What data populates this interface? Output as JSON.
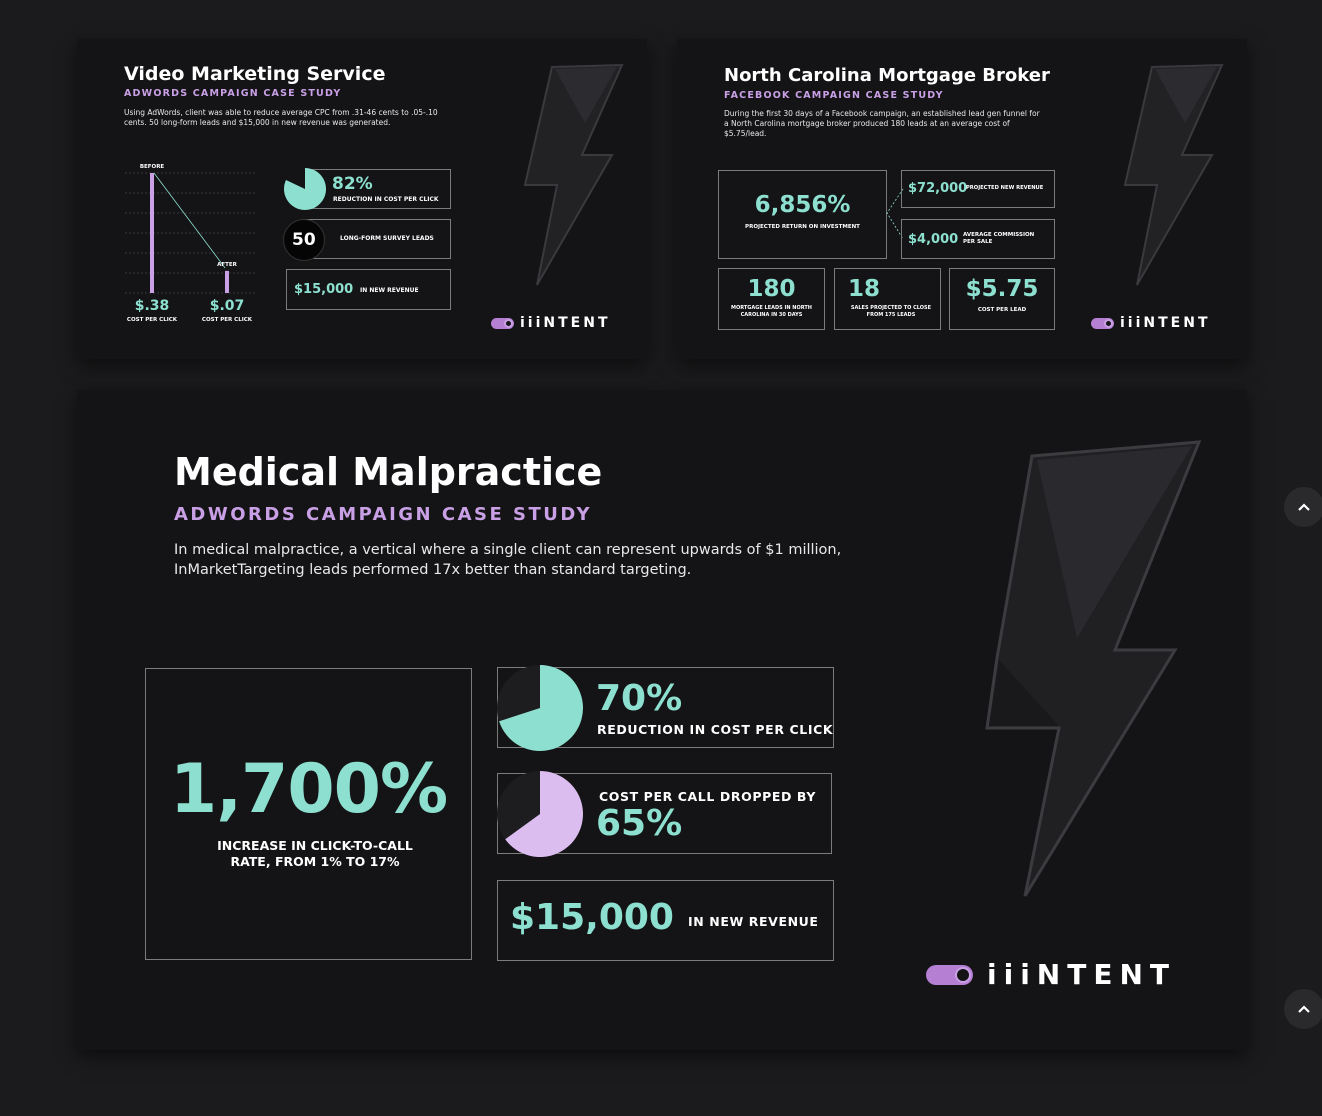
{
  "card1": {
    "title": "Video Marketing Service",
    "subtitle": "ADWORDS CAMPAIGN CASE STUDY",
    "description": "Using AdWords, client was able to reduce average CPC from .31-46 cents to .05-.10 cents. 50 long-form leads and $15,000 in new revenue was generated.",
    "chart_data": {
      "type": "bar",
      "categories": [
        "BEFORE",
        "AFTER"
      ],
      "values": [
        0.38,
        0.07
      ],
      "value_labels": [
        "$.38",
        "$.07"
      ],
      "xlabel": "COST PER CLICK",
      "grid": true
    },
    "stat1": {
      "value": "82%",
      "label": "REDUCTION IN COST PER CLICK",
      "fraction": 0.82
    },
    "stat2": {
      "value": "50",
      "label": "LONG-FORM SURVEY LEADS"
    },
    "stat3": {
      "value": "$15,000",
      "label": "IN NEW REVENUE"
    },
    "logo": "iiiNTENT"
  },
  "card2": {
    "title": "North Carolina Mortgage Broker",
    "subtitle": "FACEBOOK CAMPAIGN CASE STUDY",
    "description": "During the first 30 days of a Facebook campaign, an established lead gen funnel for a North Carolina mortgage broker produced 180 leads at an average cost of $5.75/lead.",
    "roi": {
      "value": "6,856%",
      "label": "PROJECTED RETURN ON INVESTMENT"
    },
    "revenue": {
      "value": "$72,000",
      "label": "PROJECTED NEW REVENUE"
    },
    "commission": {
      "value": "$4,000",
      "label": "AVERAGE COMMISSION PER SALE"
    },
    "leads": {
      "value": "180",
      "label": "MORTGAGE LEADS IN NORTH CAROLINA IN 30 DAYS"
    },
    "sales": {
      "value": "18",
      "label": "SALES PROJECTED TO CLOSE FROM 175 LEADS"
    },
    "cpl": {
      "value": "$5.75",
      "label": "COST PER LEAD"
    },
    "logo": "iiiNTENT"
  },
  "card3": {
    "title": "Medical Malpractice",
    "subtitle": "ADWORDS CAMPAIGN CASE STUDY",
    "description": "In medical malpractice, a vertical where a single client can represent upwards of $1 million, InMarketTargeting leads performed 17x better than standard targeting.",
    "big": {
      "value": "1,700%",
      "label": "INCREASE IN CLICK-TO-CALL RATE, FROM 1% TO 17%"
    },
    "stat1": {
      "value": "70%",
      "label": "REDUCTION IN COST PER CLICK",
      "fraction": 0.7
    },
    "stat2": {
      "value": "65%",
      "label": "COST PER CALL DROPPED BY",
      "fraction": 0.65
    },
    "stat3": {
      "value": "$15,000",
      "label": "IN NEW REVENUE"
    },
    "logo": "iiiNTENT"
  },
  "colors": {
    "teal": "#8de0d0",
    "lavender": "#c9a0e6",
    "card": "#141416",
    "page": "#1b1b1d"
  },
  "icons": {
    "scroll_up": "chevron-up-icon",
    "bolt": "lightning-bolt-icon"
  }
}
